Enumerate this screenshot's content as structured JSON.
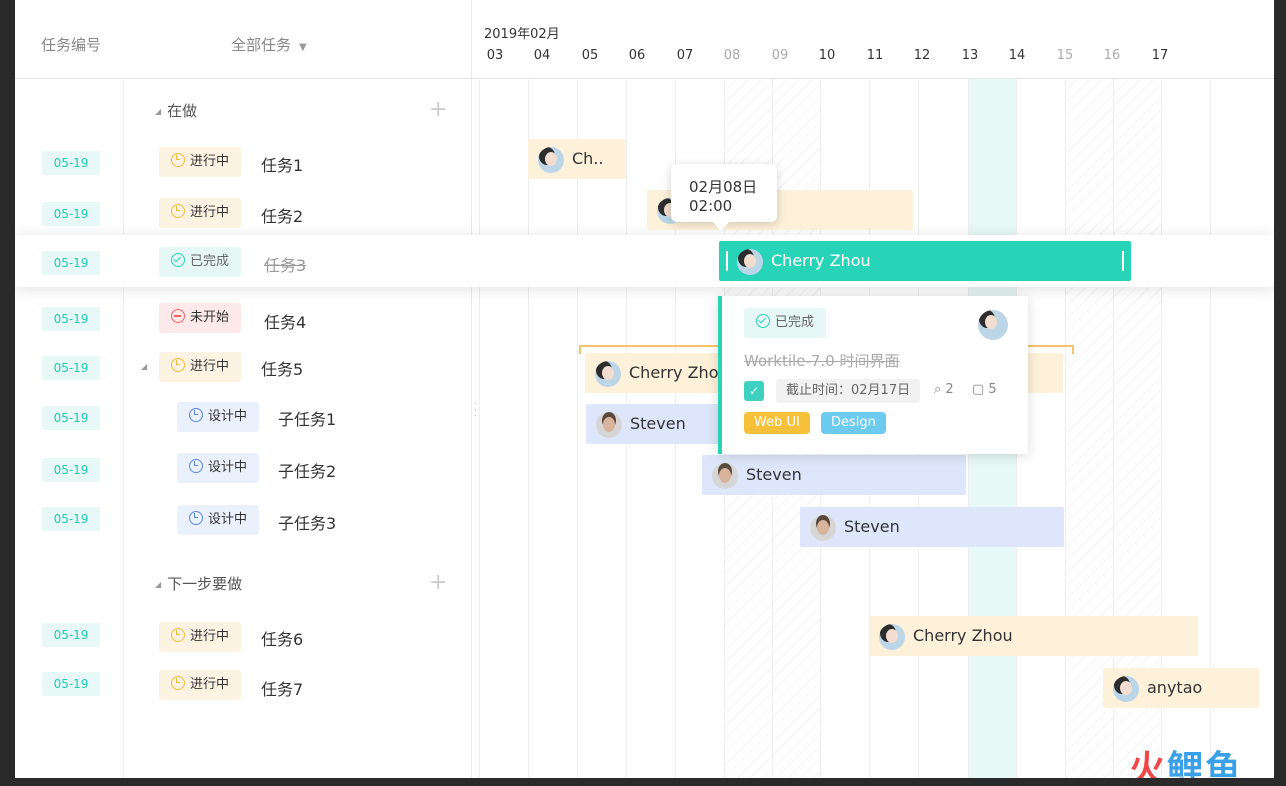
{
  "header": {
    "col_id": "任务编号",
    "col_filter": "全部任务",
    "month": "2019年02月",
    "days": [
      "03",
      "04",
      "05",
      "06",
      "07",
      "08",
      "09",
      "10",
      "11",
      "12",
      "13",
      "14",
      "15",
      "16",
      "17"
    ],
    "weekend_days": [
      "08",
      "09",
      "15",
      "16"
    ]
  },
  "groups": [
    {
      "label": "在做"
    },
    {
      "label": "下一步要做"
    }
  ],
  "tasks": [
    {
      "date": "05-19",
      "status": "进行中",
      "name": "任务1"
    },
    {
      "date": "05-19",
      "status": "进行中",
      "name": "任务2"
    },
    {
      "date": "05-19",
      "status": "已完成",
      "name": "任务3"
    },
    {
      "date": "05-19",
      "status": "未开始",
      "name": "任务4"
    },
    {
      "date": "05-19",
      "status": "进行中",
      "name": "任务5"
    },
    {
      "date": "05-19",
      "status": "设计中",
      "name": "子任务1"
    },
    {
      "date": "05-19",
      "status": "设计中",
      "name": "子任务2"
    },
    {
      "date": "05-19",
      "status": "设计中",
      "name": "子任务3"
    },
    {
      "date": "05-19",
      "status": "进行中",
      "name": "任务6"
    },
    {
      "date": "05-19",
      "status": "进行中",
      "name": "任务7"
    }
  ],
  "bars": [
    {
      "label": "Ch..",
      "avatar": "woman-avatar"
    },
    {
      "label": "",
      "avatar": "woman-avatar"
    },
    {
      "label": "Cherry Zhou",
      "avatar": "woman-avatar"
    },
    {
      "label": "Cherry Zhou",
      "avatar": "woman-avatar"
    },
    {
      "label": "Steven",
      "avatar": "man-avatar"
    },
    {
      "label": "Steven",
      "avatar": "man-avatar"
    },
    {
      "label": "Steven",
      "avatar": "man-avatar"
    },
    {
      "label": "Cherry Zhou",
      "avatar": "woman-avatar"
    },
    {
      "label": "anytao",
      "avatar": "woman-avatar"
    }
  ],
  "tooltip": {
    "date": "02月08日",
    "time": "02:00"
  },
  "card": {
    "status": "已完成",
    "title": "Worktile-7.0 时间界面",
    "deadline": "截止时间：02月17日",
    "attachments": "2",
    "comments": "5",
    "tags": [
      {
        "label": "Web UI",
        "color": "#f5c13b"
      },
      {
        "label": "Design",
        "color": "#6ecbf0"
      }
    ]
  },
  "colors": {
    "accent": "#27d4b7",
    "doing": "#f5b93b",
    "todo": "#f06363",
    "design": "#5b86e5"
  },
  "watermark": {
    "part1": "火",
    "part2": "鲤鱼"
  }
}
